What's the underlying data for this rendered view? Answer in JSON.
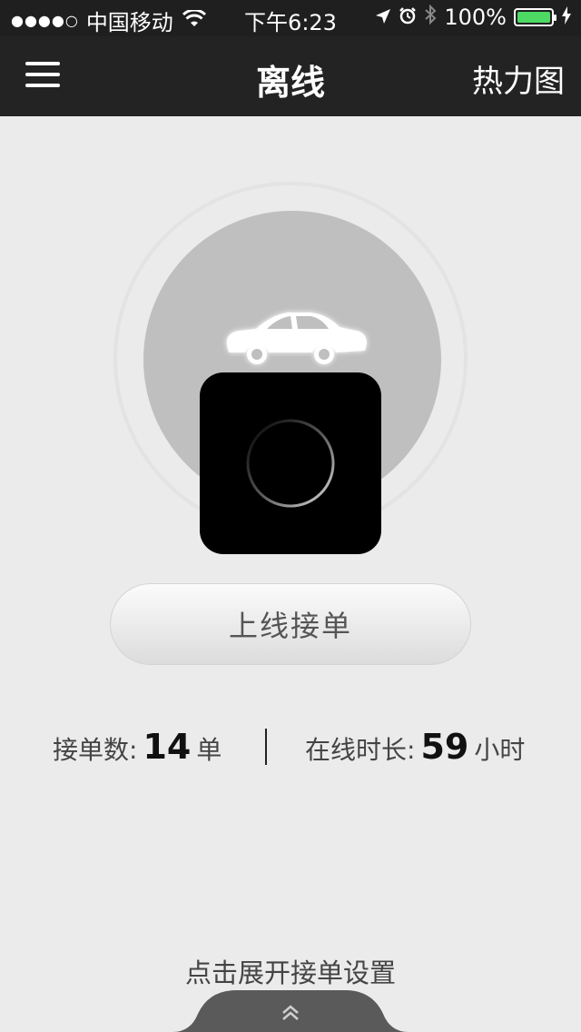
{
  "status_bar": {
    "signal": "●●●●○",
    "carrier": "中国移动",
    "time": "下午6:23",
    "battery": "100%",
    "battery_level": 1.0,
    "battery_color": "#4cd964"
  },
  "nav": {
    "title": "离线",
    "right_action": "热力图",
    "menu_icon": "hamburger-icon"
  },
  "main": {
    "online_button_label": "上线接单",
    "stats": {
      "orders_label": "接单数:",
      "orders_value": "14",
      "orders_unit": "单",
      "hours_label": "在线时长:",
      "hours_value": "59",
      "hours_unit": "小时"
    },
    "expand_hint": "点击展开接单设置"
  }
}
